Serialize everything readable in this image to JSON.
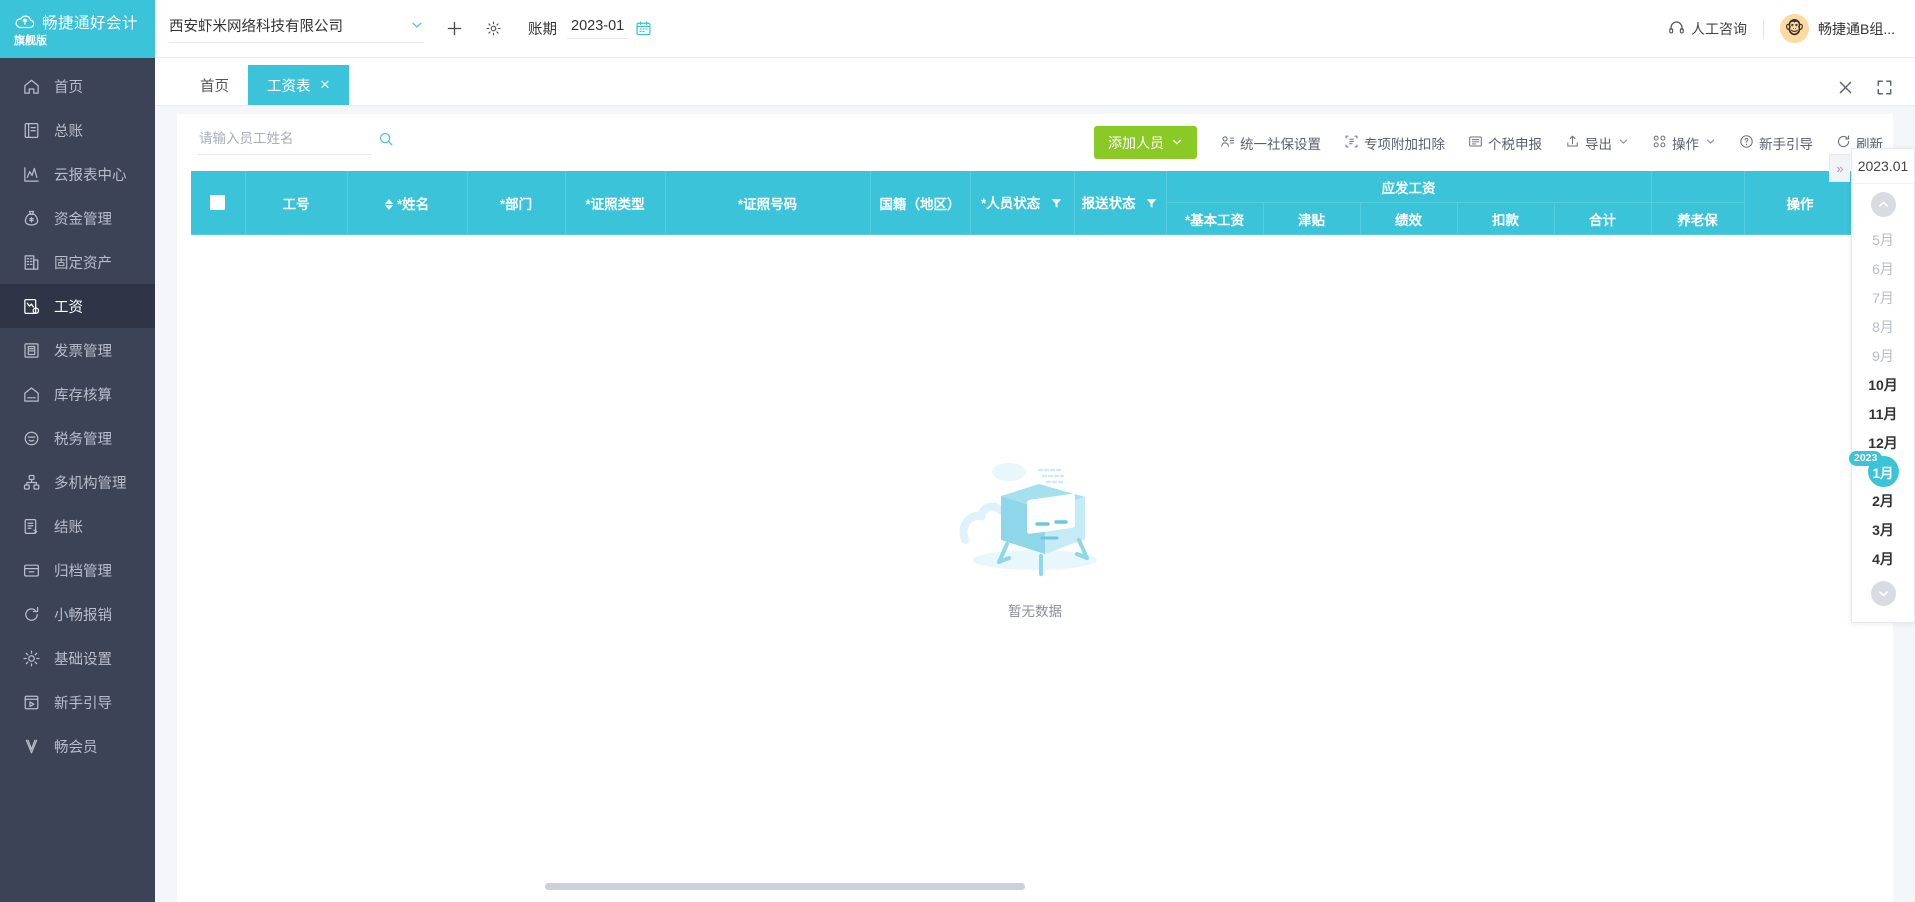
{
  "brand": {
    "name": "畅捷通好会计",
    "edition": "旗舰版",
    "logo_icon": "cloud-logo-icon"
  },
  "sidebar": {
    "items": [
      {
        "label": "首页",
        "icon": "home-icon",
        "active": false
      },
      {
        "label": "总账",
        "icon": "ledger-icon",
        "active": false
      },
      {
        "label": "云报表中心",
        "icon": "chart-icon",
        "active": false
      },
      {
        "label": "资金管理",
        "icon": "money-bag-icon",
        "active": false
      },
      {
        "label": "固定资产",
        "icon": "building-icon",
        "active": false
      },
      {
        "label": "工资",
        "icon": "payroll-icon",
        "active": true
      },
      {
        "label": "发票管理",
        "icon": "invoice-icon",
        "active": false
      },
      {
        "label": "库存核算",
        "icon": "warehouse-icon",
        "active": false
      },
      {
        "label": "税务管理",
        "icon": "tax-icon",
        "active": false
      },
      {
        "label": "多机构管理",
        "icon": "org-tree-icon",
        "active": false
      },
      {
        "label": "结账",
        "icon": "checkout-icon",
        "active": false
      },
      {
        "label": "归档管理",
        "icon": "archive-icon",
        "active": false
      },
      {
        "label": "小畅报销",
        "icon": "reimburse-icon",
        "active": false
      },
      {
        "label": "基础设置",
        "icon": "gear-icon",
        "active": false
      },
      {
        "label": "新手引导",
        "icon": "guide-play-icon",
        "active": false
      },
      {
        "label": "畅会员",
        "icon": "vip-icon",
        "active": false
      }
    ]
  },
  "topbar": {
    "company": "西安虾米网络科技有限公司",
    "company_caret_icon": "chevron-down-icon",
    "add_icon": "plus-icon",
    "settings_icon": "gear-icon",
    "period_label": "账期",
    "period_value": "2023-01",
    "calendar_icon": "calendar-icon",
    "consult_label": "人工咨询",
    "consult_icon": "headset-icon",
    "avatar_icon": "monkey-avatar",
    "user_name": "畅捷通B组..."
  },
  "tabs": {
    "items": [
      {
        "label": "首页",
        "active": false,
        "closable": false
      },
      {
        "label": "工资表",
        "active": true,
        "closable": true,
        "close_icon": "close-icon"
      }
    ],
    "close_all_icon": "close-icon",
    "fullscreen_icon": "fullscreen-icon"
  },
  "toolbar": {
    "search_placeholder": "请输入员工姓名",
    "search_value": "",
    "search_icon": "search-icon",
    "primary_button": {
      "label": "添加人员",
      "caret_icon": "chevron-down-icon",
      "color": "#8bc926"
    },
    "actions": [
      {
        "label": "统一社保设置",
        "icon": "social-security-icon",
        "caret": false
      },
      {
        "label": "专项附加扣除",
        "icon": "deduction-icon",
        "caret": false
      },
      {
        "label": "个税申报",
        "icon": "tax-report-icon",
        "caret": false
      },
      {
        "label": "导出",
        "icon": "export-icon",
        "caret": true
      },
      {
        "label": "操作",
        "icon": "operations-icon",
        "caret": true
      },
      {
        "label": "新手引导",
        "icon": "question-circle-icon",
        "caret": false
      },
      {
        "label": "刷新",
        "icon": "refresh-icon",
        "caret": false
      }
    ]
  },
  "table": {
    "select_all_icon": "checkbox-icon",
    "sort_icon": "sort-icon",
    "filter_icon": "filter-icon",
    "columns": [
      {
        "label": "工号"
      },
      {
        "label": "*姓名",
        "sortable": true
      },
      {
        "label": "*部门"
      },
      {
        "label": "*证照类型"
      },
      {
        "label": "*证照号码"
      },
      {
        "label": "国籍（地区）"
      },
      {
        "label": "*人员状态",
        "filterable": true
      },
      {
        "label": "报送状态",
        "filterable": true
      }
    ],
    "group": {
      "label": "应发工资",
      "children": [
        "*基本工资",
        "津贴",
        "绩效",
        "扣款",
        "合计"
      ]
    },
    "trailing_columns": [
      "养老保"
    ],
    "action_column": "操作",
    "empty_text": "暂无数据",
    "empty_icon": "empty-box-icon"
  },
  "period_panel": {
    "header": "2023.01",
    "collapse_icon": "chevron-right-double-icon",
    "scroll_up_icon": "chevron-up-icon",
    "scroll_down_icon": "chevron-down-icon",
    "year_badge": "2023",
    "months": [
      {
        "label": "5月",
        "dim": true,
        "selected": false
      },
      {
        "label": "6月",
        "dim": true,
        "selected": false
      },
      {
        "label": "7月",
        "dim": true,
        "selected": false
      },
      {
        "label": "8月",
        "dim": true,
        "selected": false
      },
      {
        "label": "9月",
        "dim": true,
        "selected": false
      },
      {
        "label": "10月",
        "dim": false,
        "selected": false
      },
      {
        "label": "11月",
        "dim": false,
        "selected": false
      },
      {
        "label": "12月",
        "dim": false,
        "selected": false
      },
      {
        "label": "1月",
        "dim": false,
        "selected": true
      },
      {
        "label": "2月",
        "dim": false,
        "selected": false
      },
      {
        "label": "3月",
        "dim": false,
        "selected": false
      },
      {
        "label": "4月",
        "dim": false,
        "selected": false
      }
    ]
  },
  "colors": {
    "accent": "#3ac3d9",
    "sidebar": "#3d4357",
    "primary_button": "#8bc926",
    "page_bg": "#f5f6fa"
  }
}
